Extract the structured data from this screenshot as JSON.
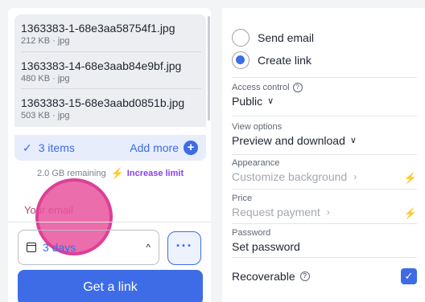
{
  "files": [
    {
      "name": "1363383-1-68e3aa58754f1.jpg",
      "meta": "212 KB · jpg"
    },
    {
      "name": "1363383-14-68e3aab84e9bf.jpg",
      "meta": "480 KB · jpg"
    },
    {
      "name": "1363383-15-68e3aabd0851b.jpg",
      "meta": "503 KB · jpg"
    }
  ],
  "items_bar": {
    "check": "✓",
    "count_label": "3 items",
    "add_more": "Add more",
    "plus": "+"
  },
  "storage": {
    "remaining": "2.0 GB remaining",
    "bolt": "⚡",
    "increase": "Increase limit"
  },
  "email": {
    "label": "Your email"
  },
  "expiry": {
    "value": "3 days",
    "chevron": "^"
  },
  "more_button": "···",
  "get_link": "Get a link",
  "delivery": {
    "send_email": "Send email",
    "create_link": "Create link",
    "selected": "create_link"
  },
  "access_control": {
    "label": "Access control",
    "value": "Public"
  },
  "view_options": {
    "label": "View options",
    "value": "Preview and download"
  },
  "appearance": {
    "label": "Appearance",
    "value": "Customize background"
  },
  "price": {
    "label": "Price",
    "value": "Request payment"
  },
  "password": {
    "label": "Password",
    "value": "Set password"
  },
  "recoverable": {
    "label": "Recoverable",
    "checked": true
  },
  "colors": {
    "accent": "#3d6ce6",
    "premium": "#8a3ff0"
  }
}
